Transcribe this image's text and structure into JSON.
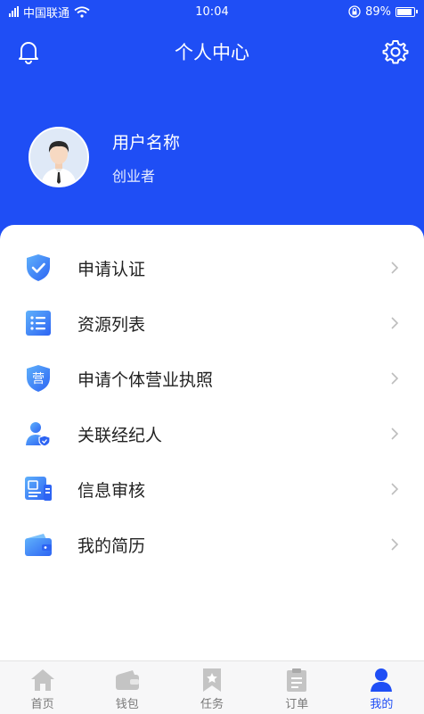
{
  "status_bar": {
    "carrier": "中国联通",
    "time": "10:04",
    "battery": "89%"
  },
  "header": {
    "title": "个人中心"
  },
  "profile": {
    "username": "用户名称",
    "role": "创业者"
  },
  "menu": {
    "items": [
      {
        "label": "申请认证",
        "icon": "shield-check-icon"
      },
      {
        "label": "资源列表",
        "icon": "list-icon"
      },
      {
        "label": "申请个体营业执照",
        "icon": "license-badge-icon",
        "badge": "营"
      },
      {
        "label": "关联经纪人",
        "icon": "user-shield-icon"
      },
      {
        "label": "信息审核",
        "icon": "id-card-icon"
      },
      {
        "label": "我的简历",
        "icon": "wallet-icon"
      }
    ]
  },
  "tabbar": {
    "tabs": [
      {
        "label": "首页",
        "icon": "home-icon"
      },
      {
        "label": "钱包",
        "icon": "wallet-icon"
      },
      {
        "label": "任务",
        "icon": "bookmark-icon"
      },
      {
        "label": "订单",
        "icon": "clipboard-icon"
      },
      {
        "label": "我的",
        "icon": "user-icon",
        "active": true
      }
    ]
  },
  "colors": {
    "primary": "#1f4ef5",
    "icon_light": "#4fa3f7",
    "tab_inactive": "#c4c4c4"
  }
}
